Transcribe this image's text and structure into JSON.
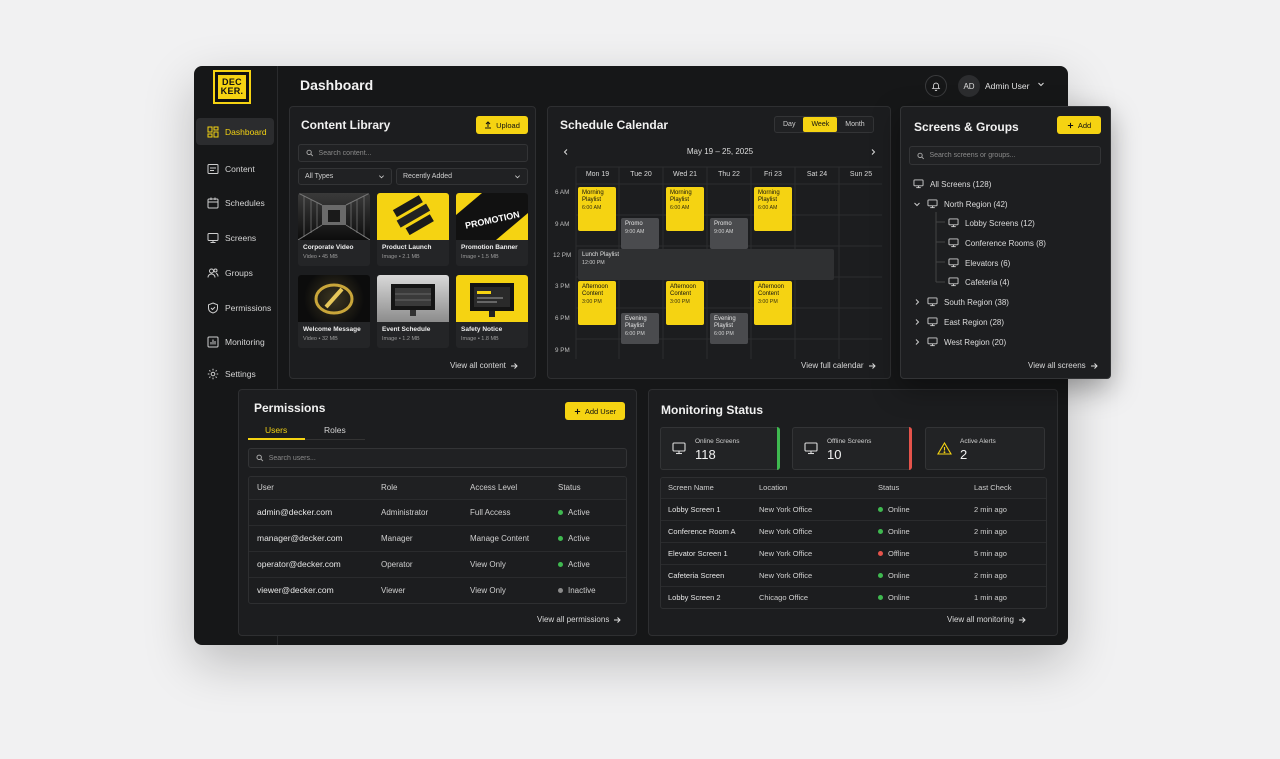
{
  "brand": {
    "logo_line1": "DEC",
    "logo_line2": "KER."
  },
  "header": {
    "title": "Dashboard",
    "user_initials": "AD",
    "user_name": "Admin User"
  },
  "sidebar": {
    "items": [
      {
        "label": "Dashboard",
        "icon": "dashboard-icon"
      },
      {
        "label": "Content",
        "icon": "content-icon"
      },
      {
        "label": "Schedules",
        "icon": "calendar-icon"
      },
      {
        "label": "Screens",
        "icon": "monitor-icon"
      },
      {
        "label": "Groups",
        "icon": "users-icon"
      },
      {
        "label": "Permissions",
        "icon": "shield-icon"
      },
      {
        "label": "Monitoring",
        "icon": "chart-icon"
      },
      {
        "label": "Settings",
        "icon": "gear-icon"
      }
    ]
  },
  "content_library": {
    "title": "Content Library",
    "upload_label": "Upload",
    "search_placeholder": "Search content...",
    "type_filter": "All Types",
    "sort_filter": "Recently Added",
    "items": [
      {
        "name": "Corporate Video",
        "meta": "Video • 45 MB"
      },
      {
        "name": "Product Launch",
        "meta": "Image • 2.1 MB"
      },
      {
        "name": "Promotion Banner",
        "meta": "Image • 1.5 MB"
      },
      {
        "name": "Welcome Message",
        "meta": "Video • 32 MB"
      },
      {
        "name": "Event Schedule",
        "meta": "Image • 1.2 MB"
      },
      {
        "name": "Safety Notice",
        "meta": "Image • 1.8 MB"
      }
    ],
    "banner_text": "PROMOTION",
    "view_all": "View all content"
  },
  "schedule": {
    "title": "Schedule Calendar",
    "views": [
      "Day",
      "Week",
      "Month"
    ],
    "active_view": "Week",
    "range": "May 19 – 25, 2025",
    "days": [
      "Mon 19",
      "Tue 20",
      "Wed 21",
      "Thu 22",
      "Fri 23",
      "Sat 24",
      "Sun 25"
    ],
    "times": [
      "6 AM",
      "9 AM",
      "12 PM",
      "3 PM",
      "6 PM",
      "9 PM"
    ],
    "events": [
      {
        "title": "Morning Playlist",
        "time": "6:00 AM"
      },
      {
        "title": "Promo",
        "time": "9:00 AM"
      },
      {
        "title": "Lunch Playlist",
        "time": "12:00 PM"
      },
      {
        "title": "Afternoon Content",
        "time": "3:00 PM"
      },
      {
        "title": "Evening Playlist",
        "time": "6:00 PM"
      }
    ],
    "view_all": "View full calendar"
  },
  "screens": {
    "title": "Screens & Groups",
    "add_label": "Add",
    "search_placeholder": "Search screens or groups...",
    "tree": [
      "All Screens (128)",
      "North Region (42)",
      "Lobby Screens (12)",
      "Conference Rooms (8)",
      "Elevators (6)",
      "Cafeteria (4)",
      "South Region (38)",
      "East Region (28)",
      "West Region (20)"
    ],
    "view_all": "View all screens"
  },
  "permissions": {
    "title": "Permissions",
    "add_label": "Add User",
    "tabs": [
      "Users",
      "Roles"
    ],
    "active_tab": "Users",
    "search_placeholder": "Search users...",
    "columns": [
      "User",
      "Role",
      "Access Level",
      "Status"
    ],
    "rows": [
      {
        "user": "admin@decker.com",
        "role": "Administrator",
        "access": "Full Access",
        "status": "Active"
      },
      {
        "user": "manager@decker.com",
        "role": "Manager",
        "access": "Manage Content",
        "status": "Active"
      },
      {
        "user": "operator@decker.com",
        "role": "Operator",
        "access": "View Only",
        "status": "Active"
      },
      {
        "user": "viewer@decker.com",
        "role": "Viewer",
        "access": "View Only",
        "status": "Inactive"
      }
    ],
    "view_all": "View all permissions"
  },
  "monitoring": {
    "title": "Monitoring Status",
    "stats": [
      {
        "label": "Online Screens",
        "value": "118",
        "color": "#3fb950"
      },
      {
        "label": "Offline Screens",
        "value": "10",
        "color": "#e5534b"
      },
      {
        "label": "Active Alerts",
        "value": "2",
        "color": "#f5d312"
      }
    ],
    "columns": [
      "Screen Name",
      "Location",
      "Status",
      "Last Check"
    ],
    "rows": [
      {
        "name": "Lobby Screen 1",
        "location": "New York Office",
        "status": "Online",
        "last": "2 min ago"
      },
      {
        "name": "Conference Room A",
        "location": "New York Office",
        "status": "Online",
        "last": "2 min ago"
      },
      {
        "name": "Elevator Screen 1",
        "location": "New York Office",
        "status": "Offline",
        "last": "5 min ago"
      },
      {
        "name": "Cafeteria Screen",
        "location": "New York Office",
        "status": "Online",
        "last": "2 min ago"
      },
      {
        "name": "Lobby Screen 2",
        "location": "Chicago Office",
        "status": "Online",
        "last": "1 min ago"
      }
    ],
    "view_all": "View all monitoring"
  },
  "colors": {
    "accent": "#f5d312",
    "online": "#3fb950",
    "offline": "#e5534b",
    "inactive": "#8a8a8a"
  }
}
